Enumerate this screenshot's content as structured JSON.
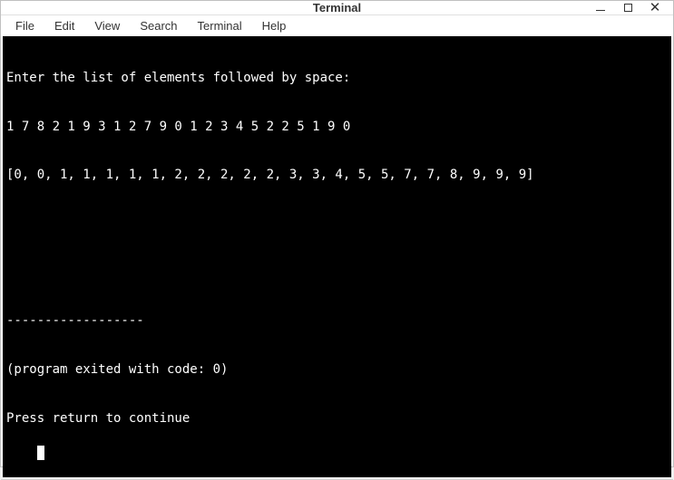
{
  "window": {
    "title": "Terminal"
  },
  "menubar": {
    "items": [
      "File",
      "Edit",
      "View",
      "Search",
      "Terminal",
      "Help"
    ]
  },
  "terminal": {
    "lines": [
      "Enter the list of elements followed by space:",
      "1 7 8 2 1 9 3 1 2 7 9 0 1 2 3 4 5 2 2 5 1 9 0",
      "[0, 0, 1, 1, 1, 1, 1, 2, 2, 2, 2, 2, 3, 3, 4, 5, 5, 7, 7, 8, 9, 9, 9]",
      "",
      "",
      "------------------",
      "(program exited with code: 0)",
      "Press return to continue"
    ]
  }
}
